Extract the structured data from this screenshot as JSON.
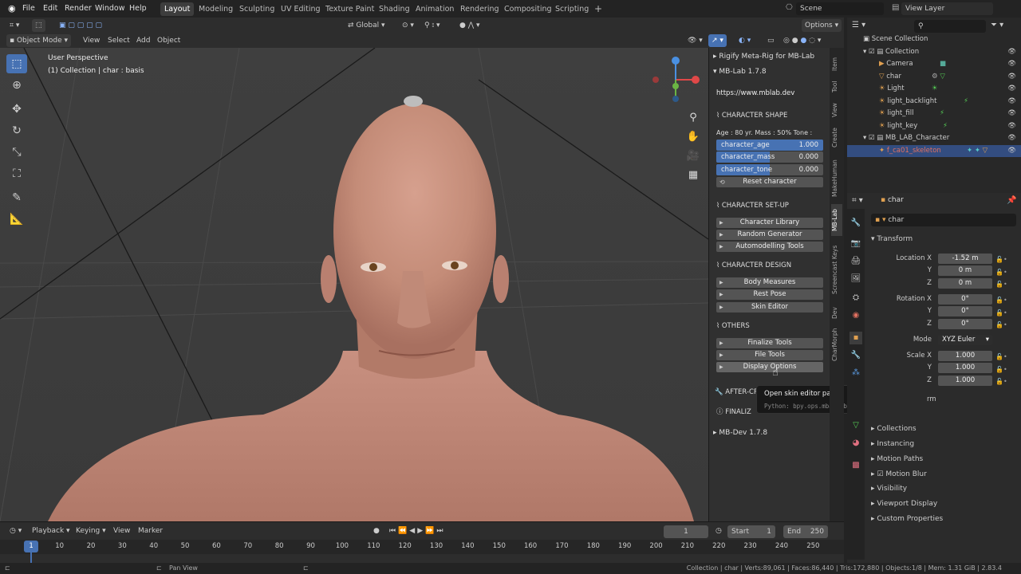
{
  "topbar": {
    "menus": [
      "File",
      "Edit",
      "Render",
      "Window",
      "Help"
    ],
    "workspaces": [
      "Layout",
      "Modeling",
      "Sculpting",
      "UV Editing",
      "Texture Paint",
      "Shading",
      "Animation",
      "Rendering",
      "Compositing",
      "Scripting"
    ],
    "active_workspace": "Layout",
    "scene": "Scene",
    "view_layer": "View Layer"
  },
  "viewport_header": {
    "mode": "Object Mode",
    "menus": [
      "View",
      "Select",
      "Add",
      "Object"
    ],
    "orientation": "Global",
    "options": "Options"
  },
  "viewport": {
    "view_name": "User Perspective",
    "collection_info": "(1) Collection | char : basis"
  },
  "npanel": {
    "rigify_title": "Rigify Meta-Rig for MB-Lab",
    "mblab_title": "MB-Lab 1.7.8",
    "url": "https://www.mblab.dev",
    "character_shape": "CHARACTER SHAPE",
    "age_info": "Age : 80 yr.  Mass : 50%  Tone :",
    "sliders": [
      {
        "label": "character_age",
        "value": "1.000",
        "fill": 1.0
      },
      {
        "label": "character_mass",
        "value": "0.000",
        "fill": 0.5
      },
      {
        "label": "character_tone",
        "value": "0.000",
        "fill": 0.5
      }
    ],
    "reset": "Reset character",
    "character_setup": "CHARACTER SET-UP",
    "setup_buttons": [
      "Character Library",
      "Random Generator",
      "Automodelling Tools"
    ],
    "character_design": "CHARACTER DESIGN",
    "design_buttons": [
      "Body Measures",
      "Rest Pose",
      "Skin Editor"
    ],
    "others": "OTHERS",
    "others_buttons": [
      "Finalize Tools",
      "File Tools",
      "Display Options"
    ],
    "after_creation": "AFTER-CR",
    "finalize": "FINALIZ",
    "mbdev_title": "MB-Dev 1.7.8",
    "tabs": [
      "Item",
      "Tool",
      "View",
      "Create",
      "MakeHuman",
      "MB-Lab",
      "Screencast Keys",
      "Dev",
      "CharMorph"
    ],
    "active_tab": "MB-Lab"
  },
  "tooltip": {
    "text": "Open skin editor panel.",
    "python": "Python: bpy.ops.mbast.button_display_on()"
  },
  "outliner": {
    "title": "Scene Collection",
    "rows": [
      {
        "label": "Collection",
        "indent": 1
      },
      {
        "label": "Camera",
        "indent": 2
      },
      {
        "label": "char",
        "indent": 2
      },
      {
        "label": "Light",
        "indent": 2
      },
      {
        "label": "light_backlight",
        "indent": 2
      },
      {
        "label": "light_fill",
        "indent": 2
      },
      {
        "label": "light_key",
        "indent": 2
      },
      {
        "label": "MB_LAB_Character",
        "indent": 1
      },
      {
        "label": "f_ca01_skeleton",
        "indent": 2
      }
    ]
  },
  "properties": {
    "object": "char",
    "object_name": "char",
    "transform": "Transform",
    "location": {
      "label": "Location X",
      "x": "-1.52 m",
      "y": "0 m",
      "z": "0 m"
    },
    "rotation": {
      "label": "Rotation X",
      "x": "0°",
      "y": "0°",
      "z": "0°"
    },
    "mode_label": "Mode",
    "mode_value": "XYZ Euler",
    "scale": {
      "label": "Scale X",
      "x": "1.000",
      "y": "1.000",
      "z": "1.000"
    },
    "axis_y": "Y",
    "axis_z": "Z",
    "hidden_partial": "rm",
    "sections": [
      "Collections",
      "Instancing",
      "Motion Paths",
      "Motion Blur",
      "Visibility",
      "Viewport Display",
      "Custom Properties"
    ]
  },
  "timeline": {
    "menus": [
      "Playback",
      "Keying",
      "View",
      "Marker"
    ],
    "current_frame": "1",
    "start_label": "Start",
    "start": "1",
    "end_label": "End",
    "end": "250",
    "ticks": [
      "1",
      "10",
      "20",
      "30",
      "40",
      "50",
      "60",
      "70",
      "80",
      "90",
      "100",
      "110",
      "120",
      "130",
      "140",
      "150",
      "160",
      "170",
      "180",
      "190",
      "200",
      "210",
      "220",
      "230",
      "240",
      "250"
    ]
  },
  "status": {
    "left": "Pan View",
    "right": "Collection | char | Verts:89,061 | Faces:86,440 | Tris:172,880 | Objects:1/8 | Mem: 1.31 GiB | 2.83.4"
  }
}
